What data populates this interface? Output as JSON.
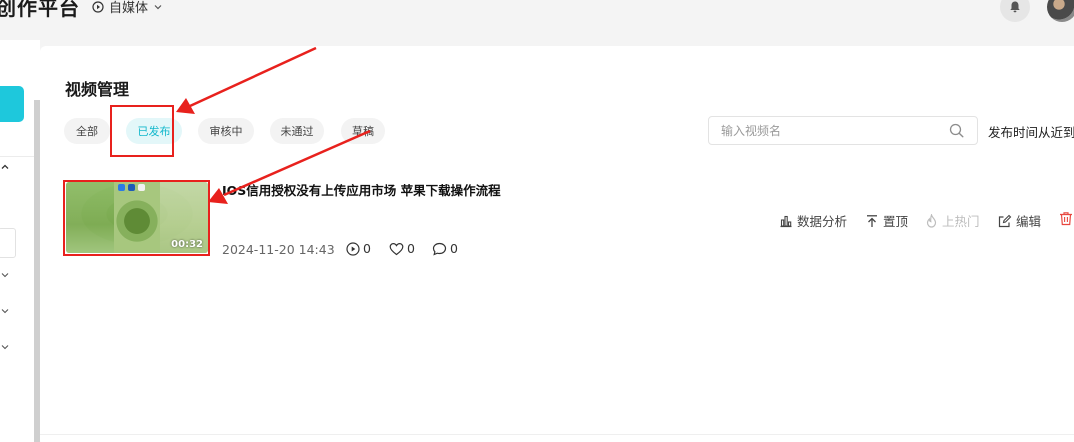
{
  "header": {
    "brand": "创作平台",
    "media_switch": "自媒体"
  },
  "page": {
    "title": "视频管理"
  },
  "tabs": [
    {
      "label": "全部",
      "active": false
    },
    {
      "label": "已发布",
      "active": true
    },
    {
      "label": "审核中",
      "active": false
    },
    {
      "label": "未通过",
      "active": false
    },
    {
      "label": "草稿",
      "active": false
    }
  ],
  "search": {
    "placeholder": "输入视频名",
    "value": ""
  },
  "date_filter": {
    "label": "发布时间从近到"
  },
  "video": {
    "title": "IOS信用授权没有上传应用市场 苹果下载操作流程",
    "date": "2024-11-20 14:43",
    "duration": "00:32",
    "plays": "0",
    "likes": "0",
    "comments": "0",
    "actions": {
      "analytics": "数据分析",
      "pin": "置顶",
      "hot": "上热门",
      "edit": "编辑"
    }
  },
  "colors": {
    "accent": "#1ec8dc",
    "active_tab_text": "#13b8cc",
    "active_tab_bg": "#e3f7f9",
    "annotation": "#e8211d",
    "delete": "#e8473f"
  }
}
